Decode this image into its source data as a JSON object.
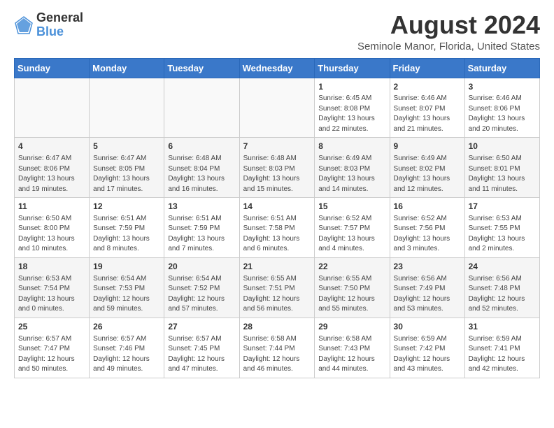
{
  "header": {
    "logo_general": "General",
    "logo_blue": "Blue",
    "month_title": "August 2024",
    "location": "Seminole Manor, Florida, United States"
  },
  "weekdays": [
    "Sunday",
    "Monday",
    "Tuesday",
    "Wednesday",
    "Thursday",
    "Friday",
    "Saturday"
  ],
  "weeks": [
    [
      {
        "day": "",
        "info": ""
      },
      {
        "day": "",
        "info": ""
      },
      {
        "day": "",
        "info": ""
      },
      {
        "day": "",
        "info": ""
      },
      {
        "day": "1",
        "info": "Sunrise: 6:45 AM\nSunset: 8:08 PM\nDaylight: 13 hours\nand 22 minutes."
      },
      {
        "day": "2",
        "info": "Sunrise: 6:46 AM\nSunset: 8:07 PM\nDaylight: 13 hours\nand 21 minutes."
      },
      {
        "day": "3",
        "info": "Sunrise: 6:46 AM\nSunset: 8:06 PM\nDaylight: 13 hours\nand 20 minutes."
      }
    ],
    [
      {
        "day": "4",
        "info": "Sunrise: 6:47 AM\nSunset: 8:06 PM\nDaylight: 13 hours\nand 19 minutes."
      },
      {
        "day": "5",
        "info": "Sunrise: 6:47 AM\nSunset: 8:05 PM\nDaylight: 13 hours\nand 17 minutes."
      },
      {
        "day": "6",
        "info": "Sunrise: 6:48 AM\nSunset: 8:04 PM\nDaylight: 13 hours\nand 16 minutes."
      },
      {
        "day": "7",
        "info": "Sunrise: 6:48 AM\nSunset: 8:03 PM\nDaylight: 13 hours\nand 15 minutes."
      },
      {
        "day": "8",
        "info": "Sunrise: 6:49 AM\nSunset: 8:03 PM\nDaylight: 13 hours\nand 14 minutes."
      },
      {
        "day": "9",
        "info": "Sunrise: 6:49 AM\nSunset: 8:02 PM\nDaylight: 13 hours\nand 12 minutes."
      },
      {
        "day": "10",
        "info": "Sunrise: 6:50 AM\nSunset: 8:01 PM\nDaylight: 13 hours\nand 11 minutes."
      }
    ],
    [
      {
        "day": "11",
        "info": "Sunrise: 6:50 AM\nSunset: 8:00 PM\nDaylight: 13 hours\nand 10 minutes."
      },
      {
        "day": "12",
        "info": "Sunrise: 6:51 AM\nSunset: 7:59 PM\nDaylight: 13 hours\nand 8 minutes."
      },
      {
        "day": "13",
        "info": "Sunrise: 6:51 AM\nSunset: 7:59 PM\nDaylight: 13 hours\nand 7 minutes."
      },
      {
        "day": "14",
        "info": "Sunrise: 6:51 AM\nSunset: 7:58 PM\nDaylight: 13 hours\nand 6 minutes."
      },
      {
        "day": "15",
        "info": "Sunrise: 6:52 AM\nSunset: 7:57 PM\nDaylight: 13 hours\nand 4 minutes."
      },
      {
        "day": "16",
        "info": "Sunrise: 6:52 AM\nSunset: 7:56 PM\nDaylight: 13 hours\nand 3 minutes."
      },
      {
        "day": "17",
        "info": "Sunrise: 6:53 AM\nSunset: 7:55 PM\nDaylight: 13 hours\nand 2 minutes."
      }
    ],
    [
      {
        "day": "18",
        "info": "Sunrise: 6:53 AM\nSunset: 7:54 PM\nDaylight: 13 hours\nand 0 minutes."
      },
      {
        "day": "19",
        "info": "Sunrise: 6:54 AM\nSunset: 7:53 PM\nDaylight: 12 hours\nand 59 minutes."
      },
      {
        "day": "20",
        "info": "Sunrise: 6:54 AM\nSunset: 7:52 PM\nDaylight: 12 hours\nand 57 minutes."
      },
      {
        "day": "21",
        "info": "Sunrise: 6:55 AM\nSunset: 7:51 PM\nDaylight: 12 hours\nand 56 minutes."
      },
      {
        "day": "22",
        "info": "Sunrise: 6:55 AM\nSunset: 7:50 PM\nDaylight: 12 hours\nand 55 minutes."
      },
      {
        "day": "23",
        "info": "Sunrise: 6:56 AM\nSunset: 7:49 PM\nDaylight: 12 hours\nand 53 minutes."
      },
      {
        "day": "24",
        "info": "Sunrise: 6:56 AM\nSunset: 7:48 PM\nDaylight: 12 hours\nand 52 minutes."
      }
    ],
    [
      {
        "day": "25",
        "info": "Sunrise: 6:57 AM\nSunset: 7:47 PM\nDaylight: 12 hours\nand 50 minutes."
      },
      {
        "day": "26",
        "info": "Sunrise: 6:57 AM\nSunset: 7:46 PM\nDaylight: 12 hours\nand 49 minutes."
      },
      {
        "day": "27",
        "info": "Sunrise: 6:57 AM\nSunset: 7:45 PM\nDaylight: 12 hours\nand 47 minutes."
      },
      {
        "day": "28",
        "info": "Sunrise: 6:58 AM\nSunset: 7:44 PM\nDaylight: 12 hours\nand 46 minutes."
      },
      {
        "day": "29",
        "info": "Sunrise: 6:58 AM\nSunset: 7:43 PM\nDaylight: 12 hours\nand 44 minutes."
      },
      {
        "day": "30",
        "info": "Sunrise: 6:59 AM\nSunset: 7:42 PM\nDaylight: 12 hours\nand 43 minutes."
      },
      {
        "day": "31",
        "info": "Sunrise: 6:59 AM\nSunset: 7:41 PM\nDaylight: 12 hours\nand 42 minutes."
      }
    ]
  ]
}
